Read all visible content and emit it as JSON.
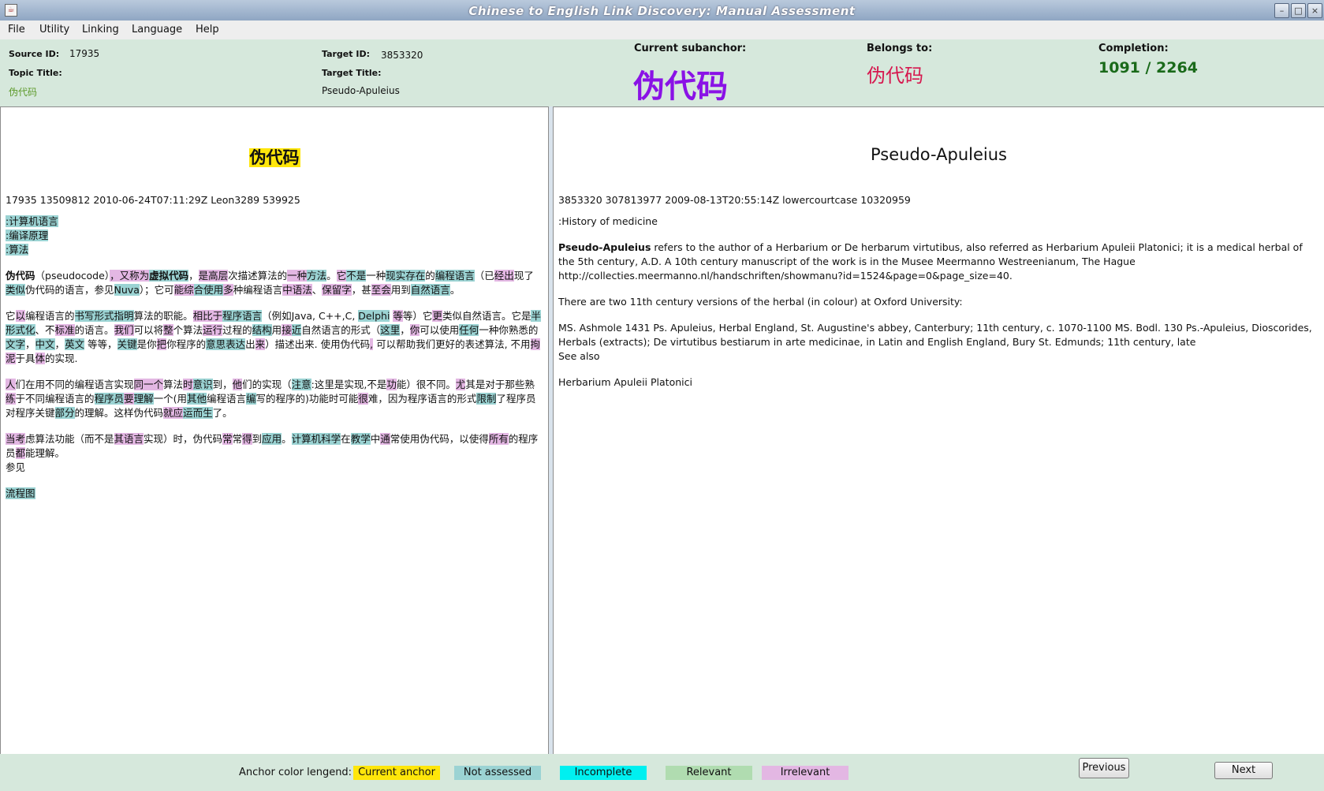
{
  "window": {
    "title": "Chinese to English Link Discovery: Manual Assessment"
  },
  "menu": [
    "File",
    "Utility",
    "Linking",
    "Language",
    "Help"
  ],
  "info": {
    "source_id_label": "Source ID:",
    "source_id": "17935",
    "topic_title_label": "Topic Title:",
    "topic_title": "伪代码",
    "target_id_label": "Target ID:",
    "target_id": "3853320",
    "target_title_label": "Target Title:",
    "target_title": "Pseudo-Apuleius",
    "subanchor_label": "Current subanchor:",
    "subanchor": "伪代码",
    "belongs_label": "Belongs to:",
    "belongs": "伪代码",
    "completion_label": "Completion:",
    "completion": "1091 / 2264"
  },
  "left_doc": {
    "title": "伪代码",
    "meta": "17935 13509812 2010-06-24T07:11:29Z Leon3289 539925",
    "categories": [
      ":计算机语言",
      ":编译原理",
      ":算法"
    ],
    "see_also_label": "参见",
    "see_also_link": "流程图"
  },
  "right_doc": {
    "title": "Pseudo-Apuleius",
    "meta": "3853320 307813977 2009-08-13T20:55:14Z lowercourtcase 10320959",
    "category": ":History of medicine",
    "para1_bold": "Pseudo-Apuleius",
    "para1": " refers to the author of a Herbarium or De herbarum virtutibus, also referred as Herbarium Apuleii Platonici; it is a medical herbal of the 5th century, A.D. A 10th century manuscript of the work is in the Musee Meermanno Westreenianum, The Hague http://collecties.meermanno.nl/handschriften/showmanu?id=1524&page=0&page_size=40.",
    "para2": "There are two 11th century versions of the herbal (in colour) at Oxford University:",
    "para3": "MS. Ashmole 1431 Ps. Apuleius, Herbal England, St. Augustine's abbey, Canterbury; 11th century, c. 1070-1100 MS. Bodl. 130 Ps.-Apuleius, Dioscorides, Herbals (extracts); De virtutibus bestiarum in arte medicinae, in Latin and English England, Bury St. Edmunds; 11th century, late",
    "see_also": "See also",
    "link1": "Herbarium Apuleii Platonici"
  },
  "footer": {
    "legend_label": "Anchor color lengend:",
    "legend": [
      {
        "label": "Current anchor",
        "color": "#ffe60a"
      },
      {
        "label": "Not assessed",
        "color": "#9bd3d3"
      },
      {
        "label": "Incomplete",
        "color": "#00f0f0"
      },
      {
        "label": "Relevant",
        "color": "#b0dcb0"
      },
      {
        "label": "Irrelevant",
        "color": "#e3b7e3"
      }
    ],
    "previous": "Previous",
    "next": "Next"
  }
}
